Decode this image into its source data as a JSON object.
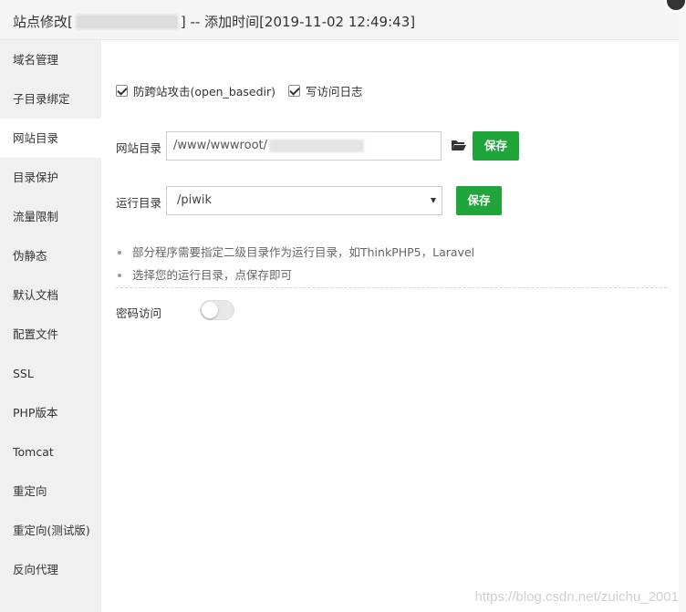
{
  "title": {
    "prefix": "站点修改[",
    "suffix": "] -- 添加时间[2019-11-02 12:49:43]"
  },
  "sidebar": {
    "items": [
      {
        "label": "域名管理"
      },
      {
        "label": "子目录绑定"
      },
      {
        "label": "网站目录",
        "active": true
      },
      {
        "label": "目录保护"
      },
      {
        "label": "流量限制"
      },
      {
        "label": "伪静态"
      },
      {
        "label": "默认文档"
      },
      {
        "label": "配置文件"
      },
      {
        "label": "SSL"
      },
      {
        "label": "PHP版本"
      },
      {
        "label": "Tomcat"
      },
      {
        "label": "重定向"
      },
      {
        "label": "重定向(测试版)"
      },
      {
        "label": "反向代理"
      }
    ]
  },
  "options": {
    "anti_xss_label": "防跨站攻击(open_basedir)",
    "anti_xss_checked": true,
    "access_log_label": "写访问日志",
    "access_log_checked": true
  },
  "site_dir": {
    "label": "网站目录",
    "value": "/www/wwwroot/",
    "save_label": "保存",
    "folder_icon": "folder-open-icon"
  },
  "run_dir": {
    "label": "运行目录",
    "selected": "/piwik",
    "save_label": "保存"
  },
  "tips": [
    "部分程序需要指定二级目录作为运行目录，如ThinkPHP5，Laravel",
    "选择您的运行目录，点保存即可"
  ],
  "password_access": {
    "label": "密码访问",
    "enabled": false
  },
  "watermark": "https://blog.csdn.net/zuichu_2001",
  "colors": {
    "accent": "#20a53a",
    "sidebar_bg": "#f0f0f0"
  }
}
